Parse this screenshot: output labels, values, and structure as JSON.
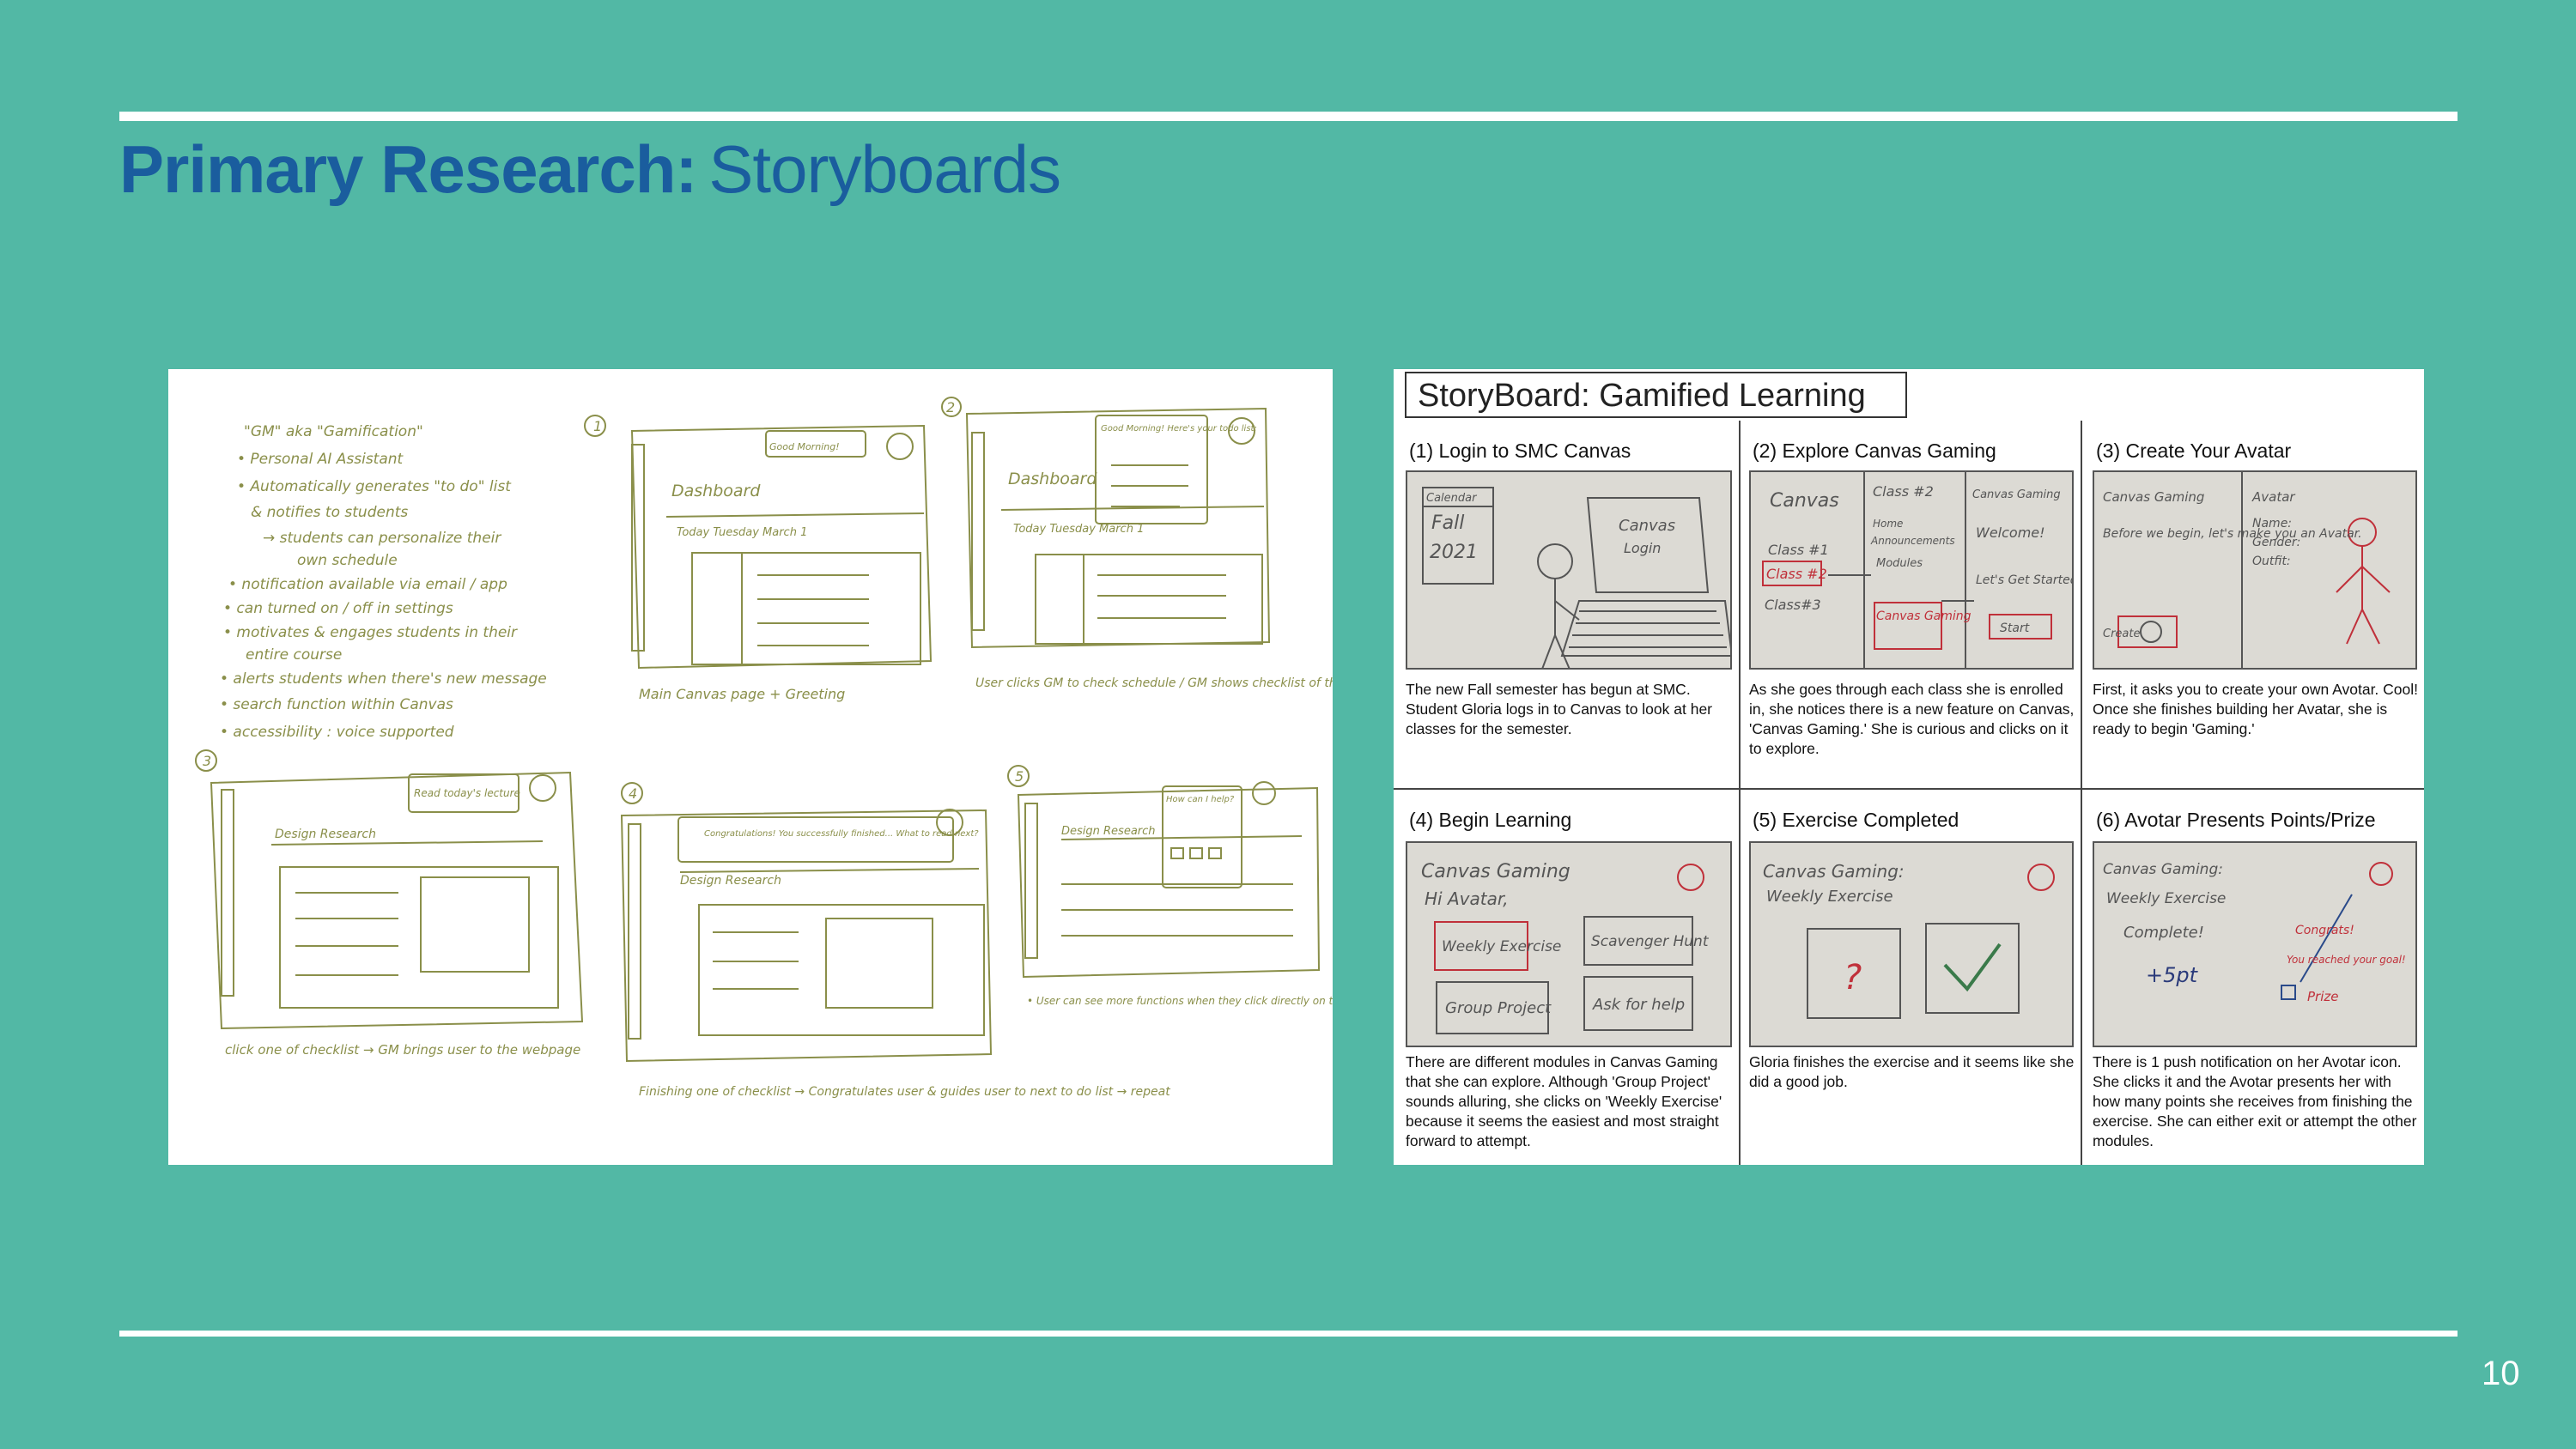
{
  "slide": {
    "title_strong": "Primary Research:",
    "title_light": "Storyboards",
    "page_number": "10"
  },
  "sketch": {
    "notes": [
      "\"GM\" aka \"Gamification\"",
      "• Personal AI Assistant",
      "• Automatically generates \"to do\" list",
      "  & notifies to students",
      "    → students can personalize their",
      "       own schedule",
      "• notification available via email / app",
      "• can turned on / off in settings",
      "• motivates & engages students in their",
      "   entire course",
      "• alerts students when there's new message",
      "• search function within Canvas",
      "• accessibility : voice supported"
    ],
    "frames": [
      {
        "number": "1",
        "bubble": "Good Morning!",
        "heading": "Dashboard",
        "sub": "Today Tuesday March 1",
        "caption": "Main Canvas page + Greeting"
      },
      {
        "number": "2",
        "bubble": "Good Morning! Here's your todo list:",
        "heading": "Dashboard",
        "sub": "Today Tuesday March 1",
        "caption": "User clicks GM to check schedule / GM shows checklist of things to do"
      },
      {
        "number": "3",
        "bubble": "Read today's lecture",
        "heading": "Design Research",
        "sub": "",
        "caption": "click one of checklist → GM brings user to the webpage"
      },
      {
        "number": "4",
        "bubble": "Congratulations! You successfully finished... What to read next?",
        "heading": "Design Research",
        "sub": "",
        "caption": "Finishing one of checklist → Congratulates user & guides user to next to do list → repeat"
      },
      {
        "number": "5",
        "bubble": "How can I help?",
        "heading": "Design Research",
        "sub": "",
        "caption": "• User can see more functions when they click directly on the icon • User can search keyword & jump to specific page"
      }
    ]
  },
  "storyboard": {
    "title": "StoryBoard: Gamified Learning",
    "cells": [
      {
        "title": "(1) Login to SMC Canvas",
        "text": "The new Fall semester has begun at SMC. Student Gloria logs in to Canvas to look at her classes for the semester.",
        "photo_labels": [
          "Calendar",
          "Fall",
          "2021",
          "Canvas",
          "Login"
        ]
      },
      {
        "title": "(2) Explore Canvas Gaming",
        "text": "As she goes through each class she is enrolled in, she notices there is a new feature on Canvas, 'Canvas Gaming.' She is curious and clicks on it to explore.",
        "photo_labels": [
          "Canvas",
          "Class #1",
          "Class #2",
          "Class#3",
          "Class #2",
          "Home",
          "Announcements",
          "Modules",
          "Canvas Gaming",
          "Canvas Gaming",
          "Welcome!",
          "Let's Get Started",
          "Start"
        ]
      },
      {
        "title": "(3) Create Your Avatar",
        "text": "First, it asks you to create your own Avotar. Cool! Once she finishes building her Avatar, she is ready to begin 'Gaming.'",
        "photo_labels": [
          "Canvas Gaming",
          "Before we begin, let's make you an Avatar.",
          "Create",
          "Avatar",
          "Name:",
          "Gender:",
          "Outfit:"
        ]
      },
      {
        "title": "(4) Begin Learning",
        "text": "There are different modules in Canvas Gaming that she can explore. Although 'Group Project' sounds alluring, she clicks on 'Weekly Exercise' because it seems the easiest and most straight forward to attempt.",
        "photo_labels": [
          "Canvas Gaming",
          "Hi Avatar,",
          "Weekly Exercise",
          "Scavenger Hunt",
          "Group Project",
          "Ask for help"
        ]
      },
      {
        "title": "(5) Exercise Completed",
        "text": "Gloria finishes the exercise and it seems like she did a good job.",
        "photo_labels": [
          "Canvas Gaming:",
          "Weekly Exercise",
          "?"
        ]
      },
      {
        "title": "(6) Avotar Presents Points/Prize",
        "text": "There is 1 push notification on her Avotar icon. She clicks it and the Avotar presents her with how many points she receives from finishing the exercise. She can either exit or attempt the other modules.",
        "photo_labels": [
          "Canvas Gaming:",
          "Weekly Exercise",
          "Complete!",
          "+5pt",
          "Congrats!",
          "You reached your goal!",
          "Prize"
        ]
      }
    ]
  },
  "colors": {
    "background": "#52b8a5",
    "title": "#1a5d9e",
    "rule": "#ffffff",
    "sketch_ink": "#8a8f4a",
    "sketch_red": "#c0303a"
  }
}
